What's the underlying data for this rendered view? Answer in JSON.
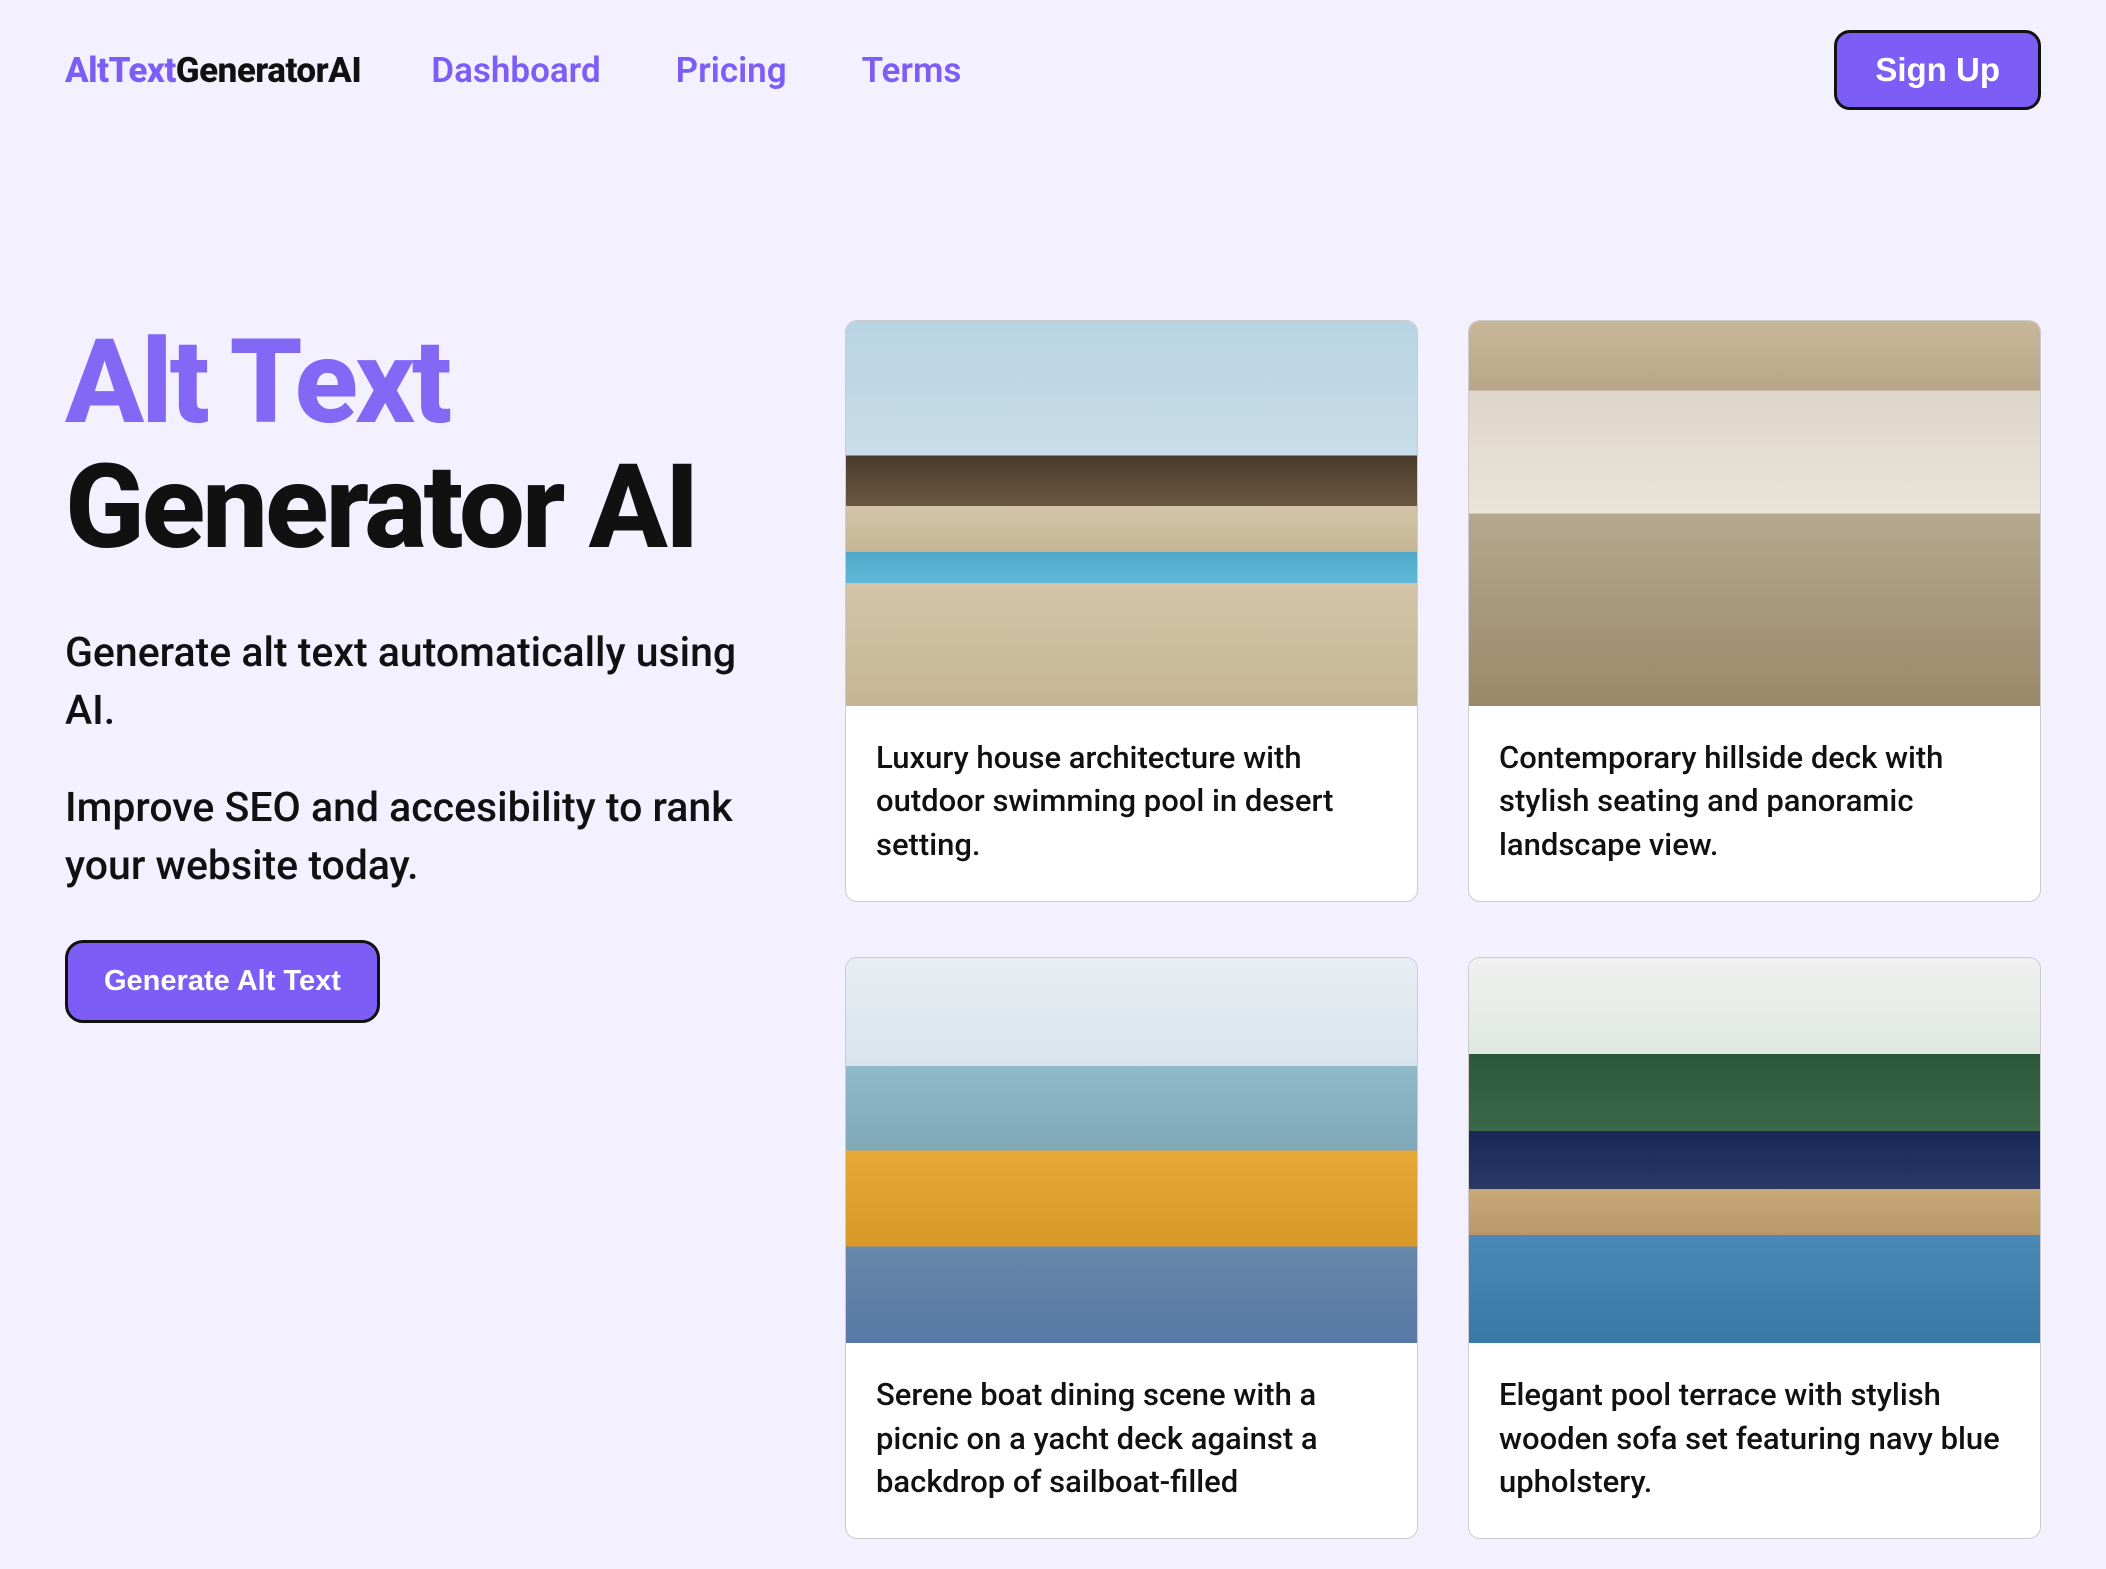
{
  "header": {
    "logo_part1": "AltText",
    "logo_part2": "GeneratorAI",
    "nav": {
      "dashboard": "Dashboard",
      "pricing": "Pricing",
      "terms": "Terms"
    },
    "signup_label": "Sign Up"
  },
  "hero": {
    "title_line1": "Alt Text",
    "title_line2": "Generator AI",
    "desc_line1": "Generate alt text automatically using AI.",
    "desc_line2": "Improve SEO and accesibility to rank your website today.",
    "cta_label": "Generate Alt Text"
  },
  "cards": [
    {
      "caption": "Luxury house architecture with outdoor swimming pool in desert setting."
    },
    {
      "caption": "Contemporary hillside deck with stylish seating and panoramic landscape view."
    },
    {
      "caption": "Serene boat dining scene with a picnic on a yacht deck against a backdrop of sailboat-filled"
    },
    {
      "caption": "Elegant pool terrace with stylish wooden sofa set featuring navy blue upholstery."
    }
  ]
}
